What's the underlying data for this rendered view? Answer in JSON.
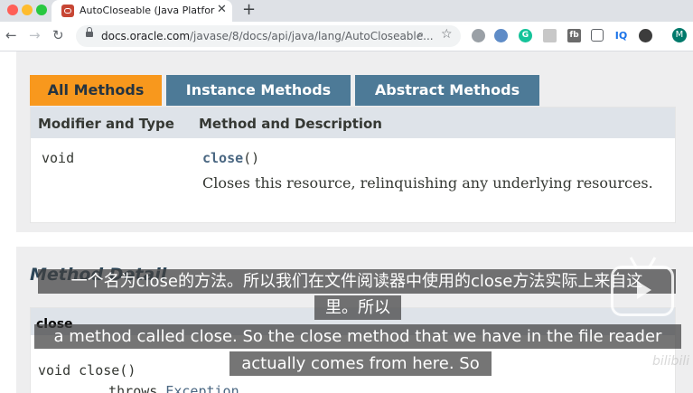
{
  "browser": {
    "tab": {
      "title": "AutoCloseable (Java Platform S",
      "close": "✕"
    },
    "new_tab": "+",
    "nav": {
      "back": "←",
      "forward": "→",
      "reload": "↻"
    },
    "url": {
      "host": "docs.oracle.com",
      "path": "/javase/8/docs/api/java/lang/AutoCloseable..."
    },
    "extensions": [
      {
        "icon": "extension-icon-1",
        "label": ""
      },
      {
        "icon": "extension-icon-2",
        "label": ""
      },
      {
        "icon": "grammarly-icon",
        "label": "G"
      },
      {
        "icon": "extension-icon-4",
        "label": ""
      },
      {
        "icon": "extension-icon-5",
        "label": "fb"
      },
      {
        "icon": "pocket-icon",
        "label": ""
      },
      {
        "icon": "iq-icon",
        "label": "IQ"
      },
      {
        "icon": "extension-icon-8",
        "label": ""
      }
    ],
    "avatar": "M"
  },
  "method_tabs": {
    "all": "All Methods",
    "instance": "Instance Methods",
    "abstract": "Abstract Methods"
  },
  "summary_table": {
    "headers": {
      "modifier": "Modifier and Type",
      "method": "Method and Description"
    },
    "row": {
      "modifier": "void",
      "method_name": "close",
      "method_params": "()",
      "description": "Closes this resource, relinquishing any underlying resources."
    }
  },
  "method_detail": {
    "title": "Method Detail",
    "name": "close",
    "signature_line1": "void close()",
    "signature_throws": "    throws ",
    "signature_exception": "Exception"
  },
  "subtitles": {
    "zh_line1": "一个名为close的方法。所以我们在文件阅读器中使用的close方法实际上来自这",
    "zh_line2": "里。所以",
    "en_line1": "a method called close. So the close method that we have in the file reader",
    "en_line2": "actually comes from here. So"
  },
  "watermark": "bilibili",
  "colors": {
    "active_tab": "#f8981d",
    "inactive_tab": "#4d7a97",
    "table_header": "#dee3e9",
    "method_link": "#4a6782"
  }
}
